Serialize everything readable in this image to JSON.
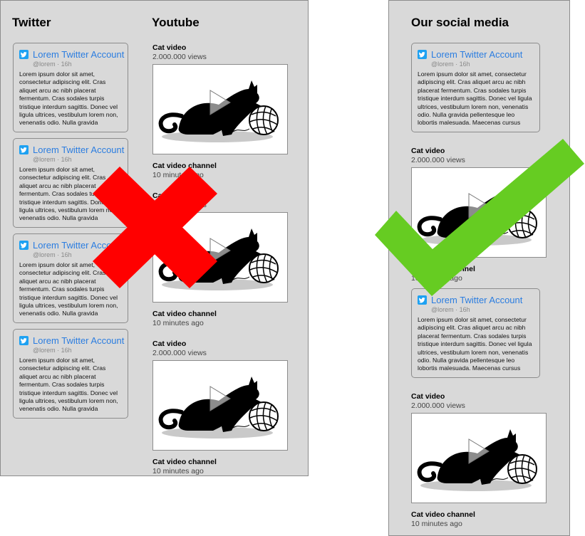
{
  "bad_layout": {
    "twitter_heading": "Twitter",
    "youtube_heading": "Youtube"
  },
  "good_layout": {
    "heading": "Our social media"
  },
  "tweet": {
    "account": "Lorem Twitter Account",
    "handle": "@lorem · 16h",
    "body_narrow": "Lorem ipsum dolor sit amet, consectetur adipiscing elit. Cras aliquet arcu ac nibh placerat fermentum. Cras sodales turpis tristique interdum sagittis. Donec vel ligula ultrices, vestibulum lorem non, venenatis odio. Nulla gravida",
    "body_wide": "Lorem ipsum dolor sit amet, consectetur adipiscing elit. Cras aliquet arcu ac nibh placerat fermentum. Cras sodales turpis tristique interdum sagittis. Donec vel ligula ultrices, vestibulum lorem non, venenatis odio. Nulla gravida pellentesque leo lobortis malesuada. Maecenas cursus"
  },
  "video": {
    "title": "Cat video",
    "views": "2.000.000 views",
    "channel": "Cat video channel",
    "ago": "10 minutes ago"
  },
  "colors": {
    "panel": "#d9d9d9",
    "twitter_blue": "#2b7de0",
    "cross": "#ff0000",
    "check": "#66cc22"
  },
  "icons": [
    "twitter-icon",
    "play-icon",
    "cat-illustration",
    "cross-mark-icon",
    "check-mark-icon"
  ]
}
